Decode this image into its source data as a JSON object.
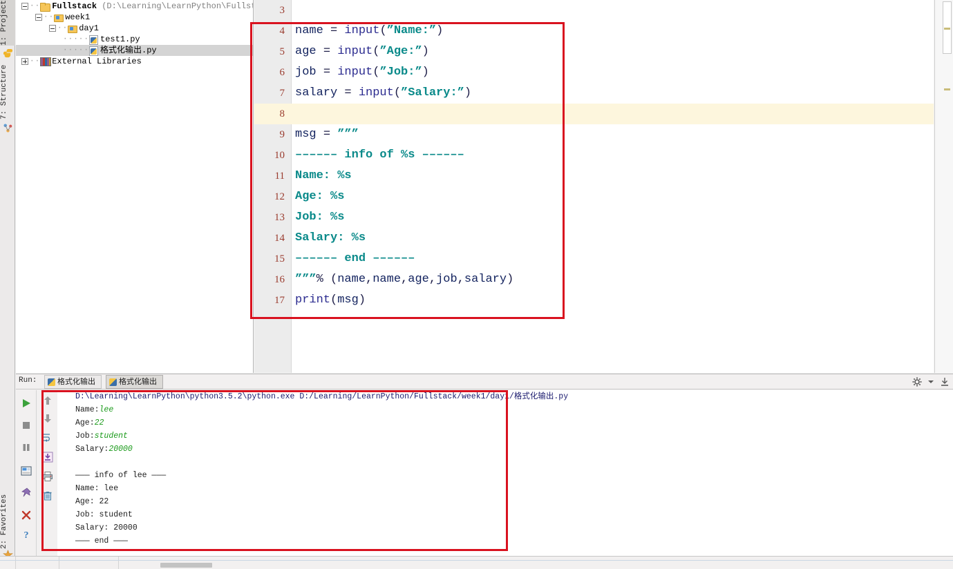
{
  "rail": {
    "project_tab": "1: Project",
    "structure_tab": "7: Structure",
    "favorites_tab": "2: Favorites",
    "python_icon": "python-icon",
    "structure_icon": "structure-icon",
    "star_icon": "star-icon"
  },
  "project_tree": {
    "nodes": [
      {
        "name": "Fullstack",
        "path": "(D:\\Learning\\LearnPython\\Fullstack)",
        "icon": "folder-icon",
        "indent": 0,
        "expanded": true,
        "selected": false
      },
      {
        "name": "week1",
        "path": "",
        "icon": "module-icon",
        "indent": 1,
        "expanded": true,
        "selected": false
      },
      {
        "name": "day1",
        "path": "",
        "icon": "module-icon",
        "indent": 2,
        "expanded": true,
        "selected": false
      },
      {
        "name": "test1.py",
        "path": "",
        "icon": "python-file-icon",
        "indent": 3,
        "expanded": null,
        "selected": false
      },
      {
        "name": "格式化输出.py",
        "path": "",
        "icon": "python-file-icon",
        "indent": 3,
        "expanded": null,
        "selected": true
      },
      {
        "name": "External Libraries",
        "path": "",
        "icon": "library-icon",
        "indent": 0,
        "expanded": false,
        "selected": false
      }
    ]
  },
  "editor": {
    "lines": [
      {
        "num": "3",
        "text": "",
        "highlight": false
      },
      {
        "num": "4",
        "text": "name = input(\"Name:\")",
        "highlight": false
      },
      {
        "num": "5",
        "text": "age = input(\"Age:\")",
        "highlight": false
      },
      {
        "num": "6",
        "text": "job = input(\"Job:\")",
        "highlight": false
      },
      {
        "num": "7",
        "text": "salary = input(\"Salary:\")",
        "highlight": false
      },
      {
        "num": "8",
        "text": "",
        "highlight": true
      },
      {
        "num": "9",
        "text": "msg = \"\"\"",
        "highlight": false
      },
      {
        "num": "10",
        "text": "------ info of %s ------",
        "highlight": false
      },
      {
        "num": "11",
        "text": "Name: %s",
        "highlight": false
      },
      {
        "num": "12",
        "text": "Age: %s",
        "highlight": false
      },
      {
        "num": "13",
        "text": "Job: %s",
        "highlight": false
      },
      {
        "num": "14",
        "text": "Salary: %s",
        "highlight": false
      },
      {
        "num": "15",
        "text": "------ end ------",
        "highlight": false
      },
      {
        "num": "16",
        "text": "\"\"\"% (name,name,age,job,salary)",
        "highlight": false
      },
      {
        "num": "17",
        "text": "print(msg)",
        "highlight": false
      }
    ]
  },
  "run_panel": {
    "label": "Run:",
    "tabs": [
      {
        "label": "格式化输出",
        "active": false
      },
      {
        "label": "格式化输出",
        "active": true
      }
    ],
    "settings_icon": "gear-icon",
    "dropdown_icon": "chevron-down-icon",
    "hide_icon": "hide-window-icon",
    "tools_left": [
      "run-icon",
      "stop-icon",
      "pause-icon",
      "layout-icon",
      "pin-icon",
      "close-icon",
      "help-icon"
    ],
    "tools_right": [
      "up-arrow-icon",
      "down-arrow-icon",
      "soft-wrap-icon",
      "scroll-to-end-icon",
      "print-icon",
      "trash-icon"
    ]
  },
  "console": {
    "command": "D:\\Learning\\LearnPython\\python3.5.2\\python.exe D:/Learning/LearnPython/Fullstack/week1/day1/格式化输出.py",
    "prompts": [
      {
        "label": "Name:",
        "value": "lee"
      },
      {
        "label": "Age:",
        "value": "22"
      },
      {
        "label": "Job:",
        "value": "student"
      },
      {
        "label": "Salary:",
        "value": "20000"
      }
    ],
    "output": [
      "——— info of lee ———",
      "Name: lee",
      "Age: 22",
      "Job: student",
      "Salary: 20000",
      "——— end ———"
    ]
  },
  "colors": {
    "annotation_red": "#d9121f",
    "string_teal": "#0a8a8a",
    "line_number": "#9a3b2e",
    "highlight_line": "#fdf6dd",
    "input_value_green": "#1a9a1a"
  }
}
